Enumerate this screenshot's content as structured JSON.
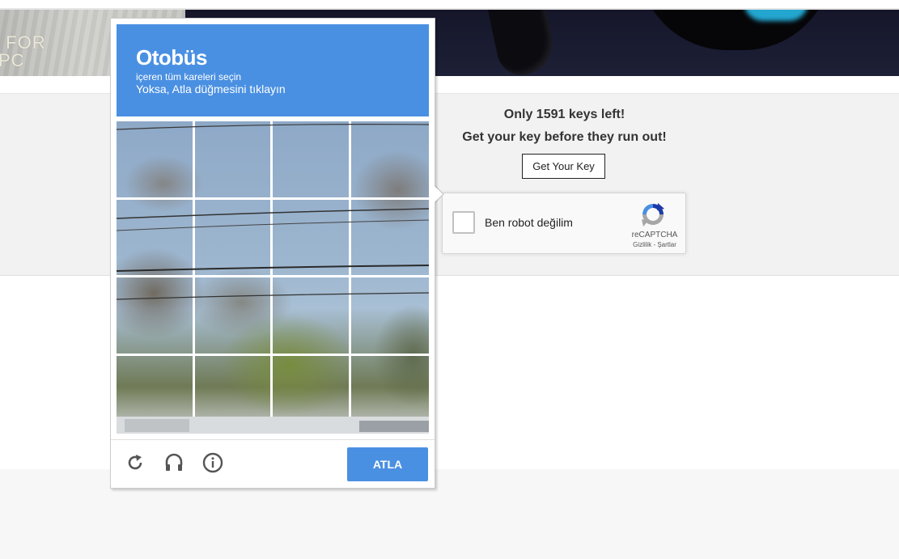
{
  "banner": {
    "left_text_line1": "T FOR",
    "left_text_line2": "PC"
  },
  "promo": {
    "keys_left": "Only 1591 keys left!",
    "subtitle": "Get your key before they run out!",
    "button_label": "Get Your Key"
  },
  "recaptcha_widget": {
    "label": "Ben robot değilim",
    "brand": "reCAPTCHA",
    "terms": "Gizlilik - Şartlar"
  },
  "challenge": {
    "target": "Otobüs",
    "instruction_line1": "içeren tüm kareleri seçin",
    "instruction_line2": "Yoksa, Atla düğmesini tıklayın",
    "skip_label": "ATLA",
    "tiles": [
      1,
      2,
      3,
      4,
      5,
      6,
      7,
      8,
      9,
      10,
      11,
      12,
      13,
      14,
      15,
      16
    ],
    "footer_icons": [
      "reload-icon",
      "headphones-icon",
      "info-icon"
    ]
  },
  "colors": {
    "accent": "#4a90e2",
    "promo_bg": "#f2f2f2",
    "banner_dark": "#15162a"
  }
}
